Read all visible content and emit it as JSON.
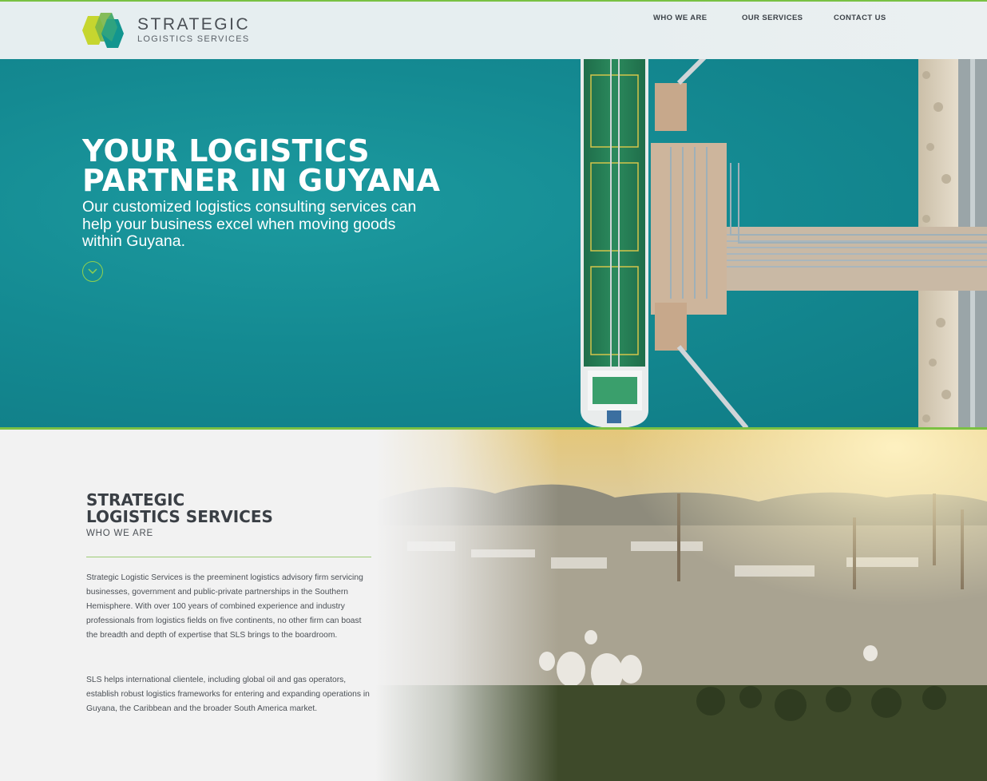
{
  "header": {
    "logo": {
      "word": "STRATEGIC",
      "sub": "LOGISTICS SERVICES"
    },
    "nav": [
      "WHO WE ARE",
      "OUR SERVICES",
      "CONTACT US"
    ]
  },
  "hero": {
    "title_line1": "YOUR LOGISTICS",
    "title_line2": "PARTNER IN GUYANA",
    "subtitle": "Our customized logistics consulting services can help your business excel when moving goods within Guyana.",
    "scroll_icon": "chevron-down-icon"
  },
  "about": {
    "title_line1": "STRATEGIC",
    "title_line2": "LOGISTICS SERVICES",
    "label": "WHO WE ARE",
    "paragraphs": [
      "Strategic Logistic Services is the preeminent logistics advisory firm servicing businesses, government and public-private partnerships in the Southern Hemisphere. With over 100 years of combined experience and industry professionals from logistics fields on five continents, no other firm can boast the breadth and depth of expertise that SLS brings to the boardroom.",
      "SLS helps international clientele, including global oil and gas operators, establish robust logistics frameworks for entering and expanding operations in Guyana, the Caribbean and the broader South America market."
    ]
  },
  "colors": {
    "accent_green": "#79c143",
    "teal": "#148a92",
    "text_dark": "#3a3f45"
  }
}
